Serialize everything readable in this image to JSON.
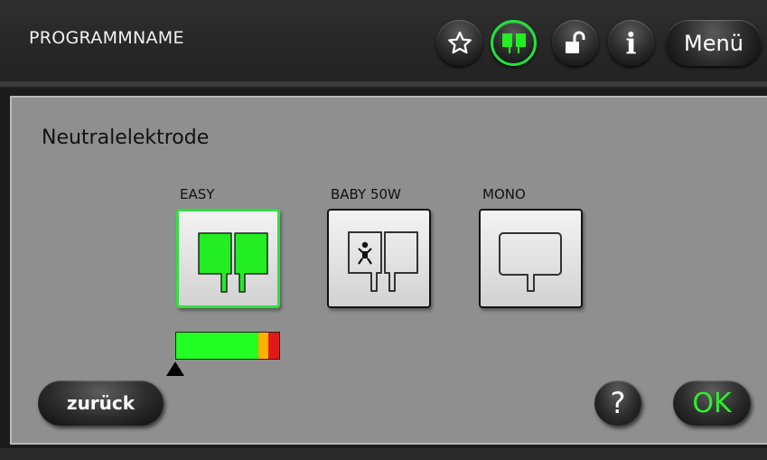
{
  "header": {
    "program_name": "PROGRAMMNAME",
    "menu_label": "Menü",
    "icons": [
      "star-icon",
      "electrode-icon",
      "unlock-icon",
      "info-icon"
    ],
    "info_glyph": "i"
  },
  "main": {
    "title": "Neutralelektrode",
    "options": [
      {
        "label": "EASY",
        "icon": "split-electrode-icon",
        "selected": true
      },
      {
        "label": "BABY 50W",
        "icon": "baby-electrode-icon",
        "selected": false
      },
      {
        "label": "MONO",
        "icon": "mono-electrode-icon",
        "selected": false
      }
    ],
    "quality_indicator": {
      "pointer_level": 0.0,
      "segments": [
        "green",
        "yellow",
        "red"
      ]
    }
  },
  "footer": {
    "back_label": "zurück",
    "help_label": "?",
    "ok_label": "OK"
  },
  "colors": {
    "accent_active": "#1fe33c",
    "electrode_fill": "#22ee22",
    "panel": "#8f8f8f"
  }
}
